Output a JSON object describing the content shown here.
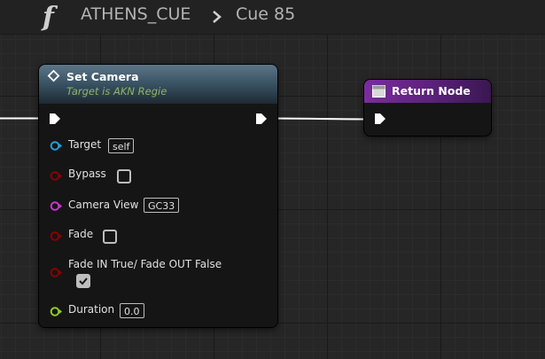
{
  "breadcrumb": {
    "graph_name": "ATHENS_CUE",
    "function_name": "Cue 85",
    "function_icon": "function-f-icon",
    "separator_icon": "chevron-right-icon"
  },
  "colors": {
    "exec_pin": "#ffffff",
    "object_pin": "#1f9fdc",
    "bool_pin": "#8c0000",
    "name_pin": "#cc33cc",
    "float_pin": "#8ecb2a",
    "set_camera_header": "#3c5566",
    "return_node_header": "#7a2d9c",
    "target_subtitle": "#8fb36a"
  },
  "set_camera_node": {
    "title": "Set Camera",
    "subtitle": "Target is AKN Regie",
    "icon": "function-diamond-icon",
    "pins": {
      "target": {
        "label": "Target",
        "value": "self"
      },
      "bypass": {
        "label": "Bypass",
        "checked": false
      },
      "camera_view": {
        "label": "Camera View",
        "value": "GC33"
      },
      "fade": {
        "label": "Fade",
        "checked": false
      },
      "fade_in_out": {
        "label": "Fade IN True/ Fade OUT False",
        "checked": true
      },
      "duration": {
        "label": "Duration",
        "value": "0.0"
      }
    }
  },
  "return_node": {
    "title": "Return Node",
    "icon": "return-node-icon"
  }
}
